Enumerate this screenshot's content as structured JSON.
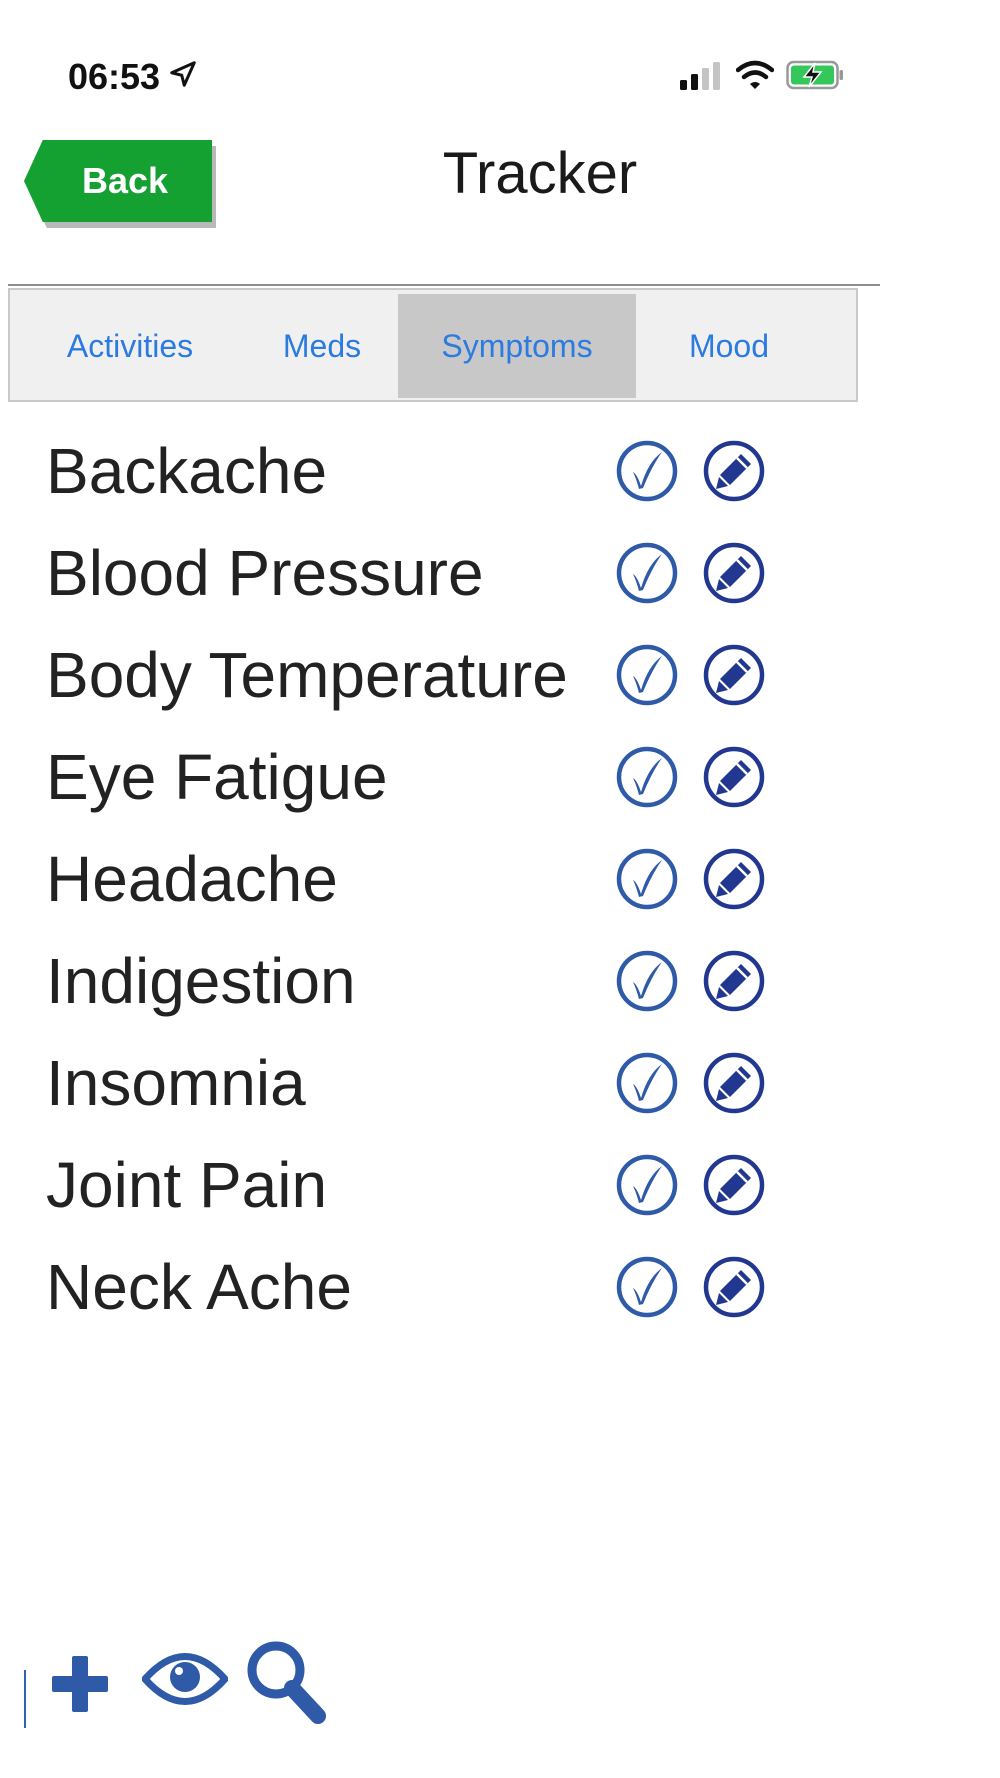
{
  "status_bar": {
    "time": "06:53",
    "icons": [
      "location-arrow-icon",
      "cellular-signal-icon",
      "wifi-icon",
      "battery-charging-icon"
    ]
  },
  "header": {
    "back_label": "Back",
    "title": "Tracker"
  },
  "tabs": [
    {
      "label": "Activities",
      "active": false
    },
    {
      "label": "Meds",
      "active": false
    },
    {
      "label": "Symptoms",
      "active": true
    },
    {
      "label": "Mood",
      "active": false
    }
  ],
  "symptoms": [
    {
      "label": "Backache"
    },
    {
      "label": "Blood Pressure"
    },
    {
      "label": "Body Temperature"
    },
    {
      "label": "Eye Fatigue"
    },
    {
      "label": "Headache"
    },
    {
      "label": "Indigestion"
    },
    {
      "label": "Insomnia"
    },
    {
      "label": "Joint Pain"
    },
    {
      "label": "Neck Ache"
    }
  ],
  "row_actions": [
    "check-circle-icon",
    "edit-pencil-icon"
  ],
  "toolbar": {
    "icons": [
      "add-plus-icon",
      "view-eye-icon",
      "search-magnifier-icon"
    ]
  },
  "colors": {
    "back_button": "#14a131",
    "tab_text": "#2b7be0",
    "active_tab_bg": "#c8c8c8",
    "icon_blue": "#2f5aa8",
    "icon_dark_blue": "#22378f"
  }
}
